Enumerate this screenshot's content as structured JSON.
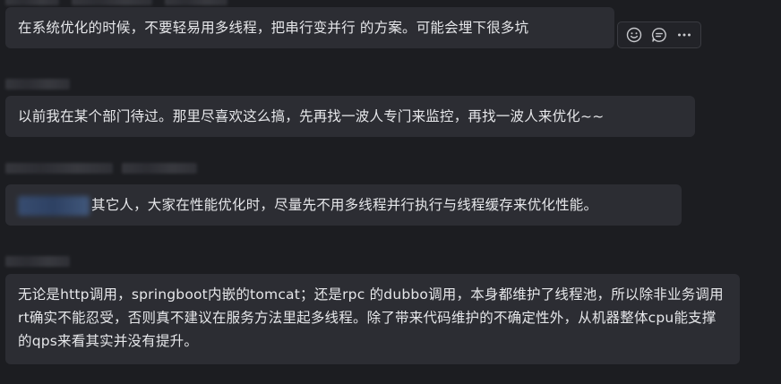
{
  "messages": [
    {
      "text": "在系统优化的时候，不要轻易用多线程，把串行变并行 的方案。可能会埋下很多坑"
    },
    {
      "text": "以前我在某个部门待过。那里尽喜欢这么搞，先再找一波人专门来监控，再找一波人来优化~~"
    },
    {
      "text": "其它人，大家在性能优化时，尽量先不用多线程并行执行与线程缓存来优化性能。"
    },
    {
      "text": "无论是http调用，springboot内嵌的tomcat；还是rpc 的dubbo调用，本身都维护了线程池，所以除非业务调用rt确实不能忍受，否则真不建议在服务方法里起多线程。除了带来代码维护的不确定性外，从机器整体cpu能支撑的qps来看其实并没有提升。"
    }
  ],
  "actions": {
    "icons": [
      "smiley-icon",
      "comment-icon",
      "more-icon"
    ]
  },
  "colors": {
    "background": "#1c1d21",
    "bubble": "#2c2d33",
    "text": "#e6e7ea"
  }
}
